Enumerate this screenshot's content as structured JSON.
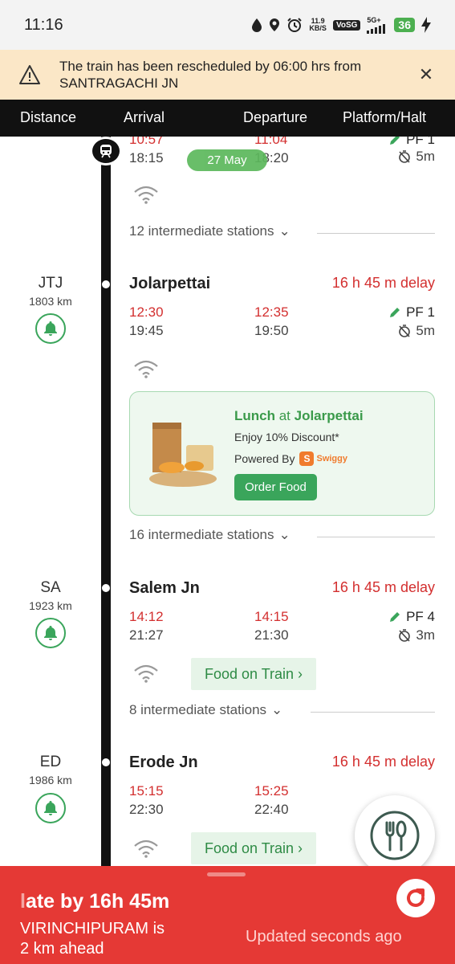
{
  "status_bar": {
    "time": "11:16",
    "net_speed_top": "11.9",
    "net_speed_bottom": "KB/S",
    "volte": "VoSG",
    "network": "5G+",
    "battery": "36"
  },
  "banner": {
    "message": "The train has been rescheduled by 06:00 hrs from SANTRAGACHI JN",
    "close_icon": "close-icon"
  },
  "header": {
    "distance": "Distance",
    "arrival": "Arrival",
    "departure": "Departure",
    "platform": "Platform/Halt"
  },
  "first_station": {
    "arr_sched": "10:57",
    "arr_actual": "18:15",
    "dep_sched": "11:04",
    "dep_actual": "18:20",
    "platform": "PF 1",
    "halt": "5m",
    "date_pill": "27 May",
    "intermediate": "12 intermediate stations"
  },
  "stations": [
    {
      "code": "JTJ",
      "km": "1803 km",
      "name": "Jolarpettai",
      "delay": "16 h 45 m delay",
      "arr_sched": "12:30",
      "arr_actual": "19:45",
      "dep_sched": "12:35",
      "dep_actual": "19:50",
      "platform": "PF 1",
      "halt": "5m",
      "intermediate": "16 intermediate stations"
    },
    {
      "code": "SA",
      "km": "1923 km",
      "name": "Salem Jn",
      "delay": "16 h 45 m delay",
      "arr_sched": "14:12",
      "arr_actual": "21:27",
      "dep_sched": "14:15",
      "dep_actual": "21:30",
      "platform": "PF 4",
      "halt": "3m",
      "food_on_train": "Food on Train ›",
      "intermediate": "8 intermediate stations"
    },
    {
      "code": "ED",
      "km": "1986 km",
      "name": "Erode Jn",
      "delay": "16 h 45 m delay",
      "arr_sched": "15:15",
      "arr_actual": "22:30",
      "dep_sched": "15:25",
      "dep_actual": "22:40",
      "food_on_train": "Food on Train ›"
    }
  ],
  "food_card": {
    "title_prefix": "Lunch",
    "title_at": " at ",
    "title_station": "Jolarpettai",
    "discount": "Enjoy 10% Discount*",
    "powered_by": "Powered By",
    "brand": "Swiggy",
    "button": "Order Food"
  },
  "bottom_panel": {
    "late_faint": "l",
    "late_text": "ate by 16h 45m",
    "ahead_line1": "VIRINCHIPURAM is",
    "ahead_line2": "2 km ahead",
    "updated": "Updated seconds  ago"
  },
  "colors": {
    "accent_green": "#3aa55b",
    "delay_red": "#d32f2f",
    "panel_red": "#e53935",
    "banner_bg": "#fbe7c7"
  }
}
